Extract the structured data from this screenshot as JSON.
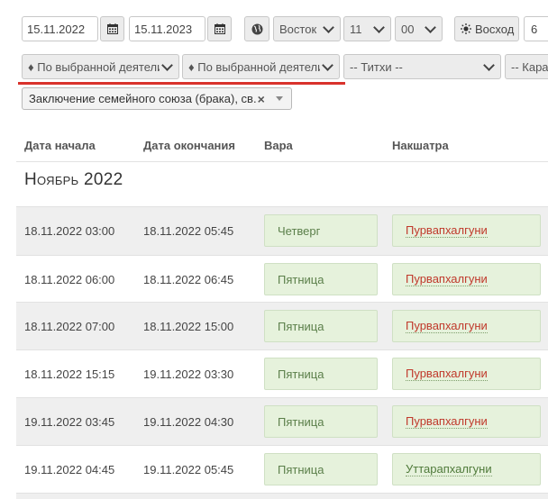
{
  "filters": {
    "date_from": "15.11.2022",
    "date_to": "15.11.2023",
    "direction": "Восток",
    "hour": "11",
    "minute": "00",
    "sunrise_label": "Восход",
    "extra_value": "6",
    "activity_select_1": "♦ По выбранной деятели",
    "activity_select_2": "♦ По выбранной деятели",
    "tithi_select": "-- Титхи --",
    "karana_select": "-- Кара",
    "selected_tag": "Заключение семейного союза (брака), св."
  },
  "table": {
    "headers": {
      "start": "Дата начала",
      "end": "Дата окончания",
      "vara": "Вара",
      "nakshatra": "Накшатра"
    },
    "month": "Ноябрь 2022",
    "rows": [
      {
        "start": "18.11.2022 03:00",
        "end": "18.11.2022 05:45",
        "vara": "Четверг",
        "nakshatra": "Пурвапхалгуни"
      },
      {
        "start": "18.11.2022 06:00",
        "end": "18.11.2022 06:45",
        "vara": "Пятница",
        "nakshatra": "Пурвапхалгуни"
      },
      {
        "start": "18.11.2022 07:00",
        "end": "18.11.2022 15:00",
        "vara": "Пятница",
        "nakshatra": "Пурвапхалгуни"
      },
      {
        "start": "18.11.2022 15:15",
        "end": "19.11.2022 03:30",
        "vara": "Пятница",
        "nakshatra": "Пурвапхалгуни"
      },
      {
        "start": "19.11.2022 03:45",
        "end": "19.11.2022 04:30",
        "vara": "Пятница",
        "nakshatra": "Пурвапхалгуни"
      },
      {
        "start": "19.11.2022 04:45",
        "end": "19.11.2022 05:45",
        "vara": "Пятница",
        "nakshatra": "Уттарапхалгуни"
      }
    ]
  },
  "icons": {
    "calendar": "calendar-icon",
    "globe": "globe-icon",
    "sun": "sun-icon",
    "remove": "close-icon",
    "dropdown": "chevron-down-icon"
  },
  "colors": {
    "accent_underline": "#d9322c",
    "vara_text": "#5b7f4a",
    "nakshatra_red": "#c0392b",
    "nakshatra_green": "#4f7a3a",
    "cell_bg": "#e6f2dc"
  }
}
